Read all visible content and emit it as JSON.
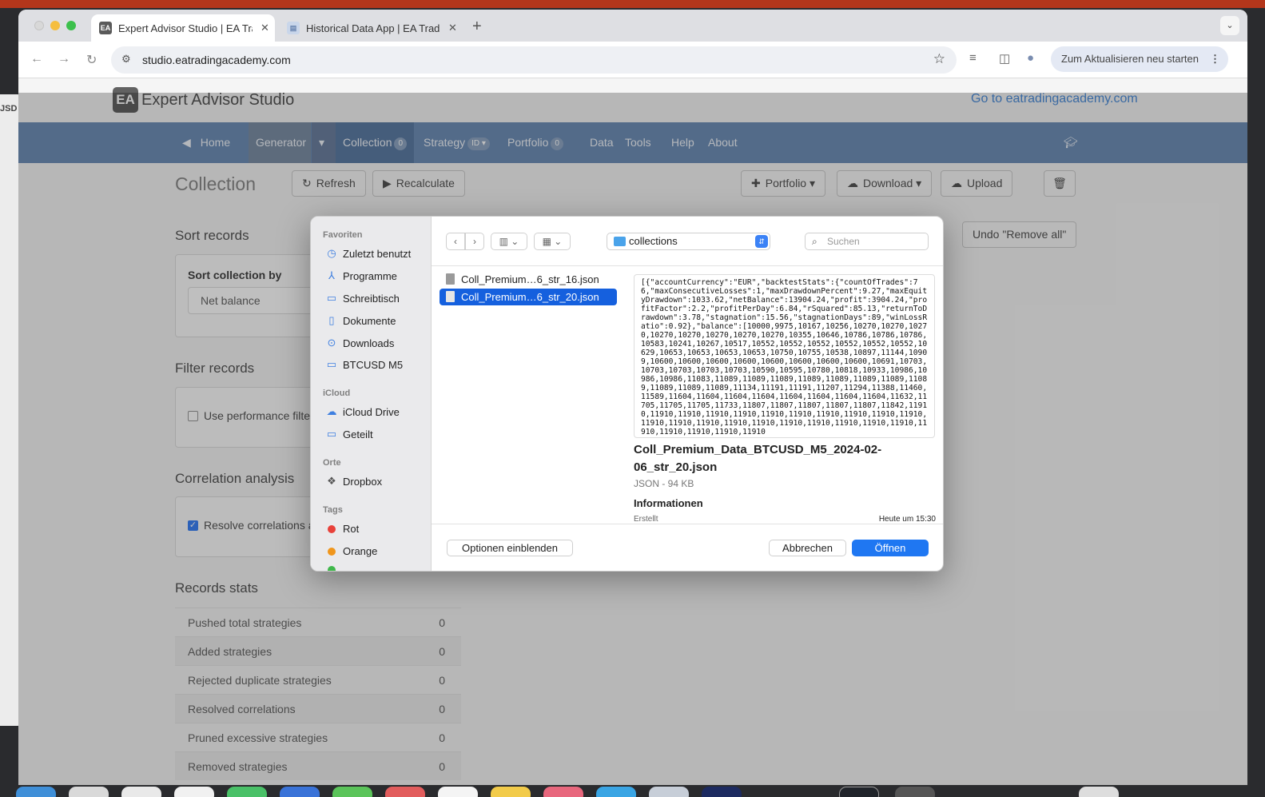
{
  "browser": {
    "tabs": [
      {
        "title": "Expert Advisor Studio | EA Trading Academy",
        "favicon": "EA"
      },
      {
        "title": "Historical Data App | EA Trading Academy",
        "favicon": "doc"
      }
    ],
    "url": "studio.eatradingacademy.com",
    "update_button": "Zum Aktualisieren neu starten"
  },
  "site": {
    "brand_logo": "EA",
    "brand_name": "Expert Advisor Studio",
    "goto_link": "Go to eatradingacademy.com",
    "nav": {
      "home": "Home",
      "generator": "Generator",
      "collection": "Collection",
      "collection_count": "0",
      "strategy": "Strategy",
      "strategy_badge": "ID",
      "portfolio": "Portfolio",
      "portfolio_count": "0",
      "data": "Data",
      "tools": "Tools",
      "help": "Help",
      "about": "About"
    }
  },
  "page": {
    "title": "Collection",
    "refresh": "Refresh",
    "recalculate": "Recalculate",
    "portfolio_btn": "Portfolio",
    "download_btn": "Download",
    "upload_btn": "Upload",
    "undo_btn": "Undo \"Remove all\"",
    "sort": {
      "heading": "Sort records",
      "label": "Sort collection by",
      "value": "Net balance"
    },
    "filter": {
      "heading": "Filter records",
      "checkbox": "Use performance filte"
    },
    "correlation": {
      "heading": "Correlation analysis",
      "checkbox": "Resolve correlations a"
    },
    "stats": {
      "heading": "Records stats",
      "rows": [
        {
          "label": "Pushed total strategies",
          "value": "0"
        },
        {
          "label": "Added strategies",
          "value": "0"
        },
        {
          "label": "Rejected duplicate strategies",
          "value": "0"
        },
        {
          "label": "Resolved correlations",
          "value": "0"
        },
        {
          "label": "Pruned excessive strategies",
          "value": "0"
        },
        {
          "label": "Removed strategies",
          "value": "0"
        }
      ]
    }
  },
  "dialog": {
    "sidebar": {
      "favorites_heading": "Favoriten",
      "favorites": [
        "Zuletzt benutzt",
        "Programme",
        "Schreibtisch",
        "Dokumente",
        "Downloads",
        "BTCUSD M5"
      ],
      "icloud_heading": "iCloud",
      "icloud": [
        "iCloud Drive",
        "Geteilt"
      ],
      "places_heading": "Orte",
      "places": [
        "Dropbox"
      ],
      "tags_heading": "Tags",
      "tags": [
        {
          "name": "Rot",
          "color": "#e8413a"
        },
        {
          "name": "Orange",
          "color": "#f0961c"
        }
      ]
    },
    "folder": "collections",
    "search_placeholder": "Suchen",
    "files": [
      "Coll_Premium…6_str_16.json",
      "Coll_Premium…6_str_20.json"
    ],
    "preview": {
      "json_text": "[{\"accountCurrency\":\"EUR\",\"backtestStats\":{\"countOfTrades\":76,\"maxConsecutiveLosses\":1,\"maxDrawdownPercent\":9.27,\"maxEquityDrawdown\":1033.62,\"netBalance\":13904.24,\"profit\":3904.24,\"profitFactor\":2.2,\"profitPerDay\":6.84,\"rSquared\":85.13,\"returnToDrawdown\":3.78,\"stagnation\":15.56,\"stagnationDays\":89,\"winLossRatio\":0.92},\"balance\":[10000,9975,10167,10256,10270,10270,10270,10270,10270,10270,10270,10270,10355,10646,10786,10786,10786,10583,10241,10267,10517,10552,10552,10552,10552,10552,10552,10629,10653,10653,10653,10653,10750,10755,10538,10897,11144,10909,10600,10600,10600,10600,10600,10600,10600,10600,10691,10703,10703,10703,10703,10703,10590,10595,10780,10818,10933,10986,10986,10986,11083,11089,11089,11089,11089,11089,11089,11089,11089,11089,11089,11089,11134,11191,11191,11207,11294,11388,11460,11589,11604,11604,11604,11604,11604,11604,11604,11604,11632,11705,11705,11705,11733,11807,11807,11807,11807,11807,11842,11910,11910,11910,11910,11910,11910,11910,11910,11910,11910,11910,11910,11910,11910,11910,11910,11910,11910,11910,11910,11910,11910,11910,11910,11910,11910",
      "name": "Coll_Premium_Data_BTCUSD_M5_2024-02-06_str_20.json",
      "meta": "JSON - 94 KB",
      "info_heading": "Informationen",
      "created_label": "Erstellt",
      "created_value": "Heute um 15:30"
    },
    "options_btn": "Optionen einblenden",
    "cancel_btn": "Abbrechen",
    "open_btn": "Öffnen"
  },
  "background": {
    "left_window_text": "JSD"
  }
}
